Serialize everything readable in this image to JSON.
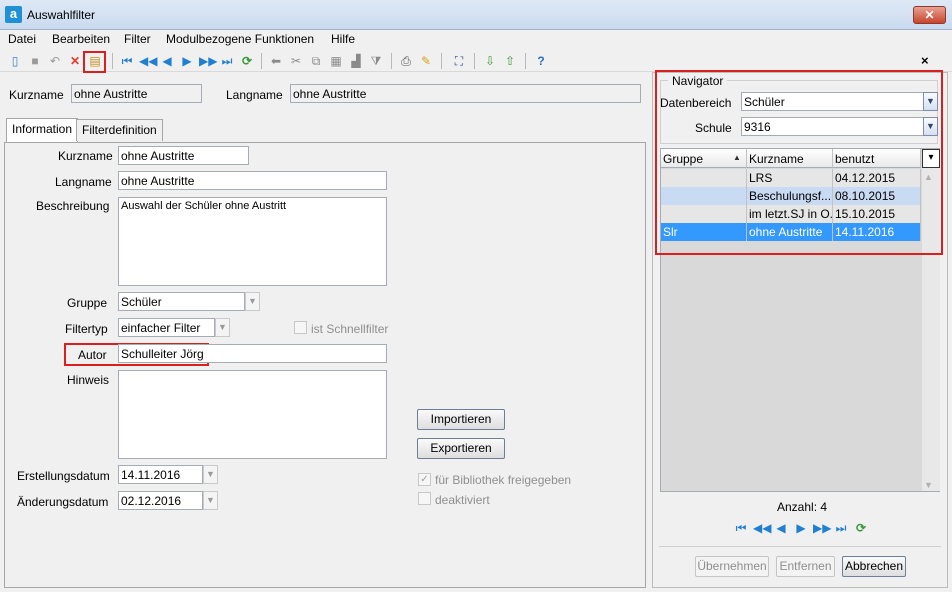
{
  "window": {
    "title": "Auswahlfilter",
    "app_icon_letter": "a",
    "close_symbol": "✕"
  },
  "menu": [
    {
      "label": "Datei"
    },
    {
      "label": "Bearbeiten"
    },
    {
      "label": "Filter"
    },
    {
      "label": "Modulbezogene Funktionen"
    },
    {
      "label": "Hilfe"
    }
  ],
  "toolbar": {
    "icons": [
      "new-icon",
      "save-icon",
      "undo-icon",
      "delete-icon",
      "filter-edit-icon",
      "first-icon",
      "prev-page-icon",
      "prev-icon",
      "next-icon",
      "next-page-icon",
      "last-icon",
      "refresh-icon",
      "back-arrow-icon",
      "cut-icon",
      "copy-icon",
      "paste-icon",
      "stamp-icon",
      "filter-icon",
      "print-icon",
      "brush-icon",
      "fit-icon",
      "import-icon",
      "export-icon",
      "help-icon"
    ],
    "close_label": "×"
  },
  "header": {
    "kurzname_label": "Kurzname",
    "kurzname_value": "ohne Austritte",
    "langname_label": "Langname",
    "langname_value": "ohne Austritte"
  },
  "tabs": [
    {
      "label": "Information",
      "active": true
    },
    {
      "label": "Filterdefinition",
      "active": false
    }
  ],
  "form": {
    "kurzname_label": "Kurzname",
    "kurzname_value": "ohne Austritte",
    "langname_label": "Langname",
    "langname_value": "ohne Austritte",
    "beschreibung_label": "Beschreibung",
    "beschreibung_value": "Auswahl der Schüler ohne Austritt",
    "gruppe_label": "Gruppe",
    "gruppe_value": "Schüler",
    "filtertyp_label": "Filtertyp",
    "filtertyp_value": "einfacher Filter",
    "schnellfilter_label": "ist Schnellfilter",
    "schnellfilter_checked": false,
    "autor_label": "Autor",
    "autor_value": "Schulleiter Jörg",
    "hinweis_label": "Hinweis",
    "hinweis_value": "",
    "import_button": "Importieren",
    "export_button": "Exportieren",
    "bibliothek_label": "für Bibliothek freigegeben",
    "bibliothek_checked": true,
    "deaktiviert_label": "deaktiviert",
    "deaktiviert_checked": false,
    "erstellungsdatum_label": "Erstellungsdatum",
    "erstellungsdatum_value": "14.11.2016",
    "aenderungsdatum_label": "Änderungsdatum",
    "aenderungsdatum_value": "02.12.2016"
  },
  "navigator": {
    "title": "Navigator",
    "datenbereich_label": "Datenbereich",
    "datenbereich_value": "Schüler",
    "schule_label": "Schule",
    "schule_value": "9316",
    "columns": [
      "Gruppe",
      "Kurzname",
      "benutzt"
    ],
    "rows": [
      {
        "gruppe": "",
        "kurzname": "LRS",
        "benutzt": "04.12.2015"
      },
      {
        "gruppe": "",
        "kurzname": "Beschulungsf...",
        "benutzt": "08.10.2015"
      },
      {
        "gruppe": "",
        "kurzname": "im letzt.SJ in O...",
        "benutzt": "15.10.2015"
      },
      {
        "gruppe": "Slr",
        "kurzname": "ohne Austritte",
        "benutzt": "14.11.2016"
      }
    ],
    "count_label": "Anzahl: 4",
    "buttons": {
      "uebernehmen": "Übernehmen",
      "entfernen": "Entfernen",
      "abbrechen": "Abbrechen"
    }
  },
  "colors": {
    "highlight": "#d9201e",
    "selection": "#3399ff",
    "alt_row": "#c9daf3"
  }
}
